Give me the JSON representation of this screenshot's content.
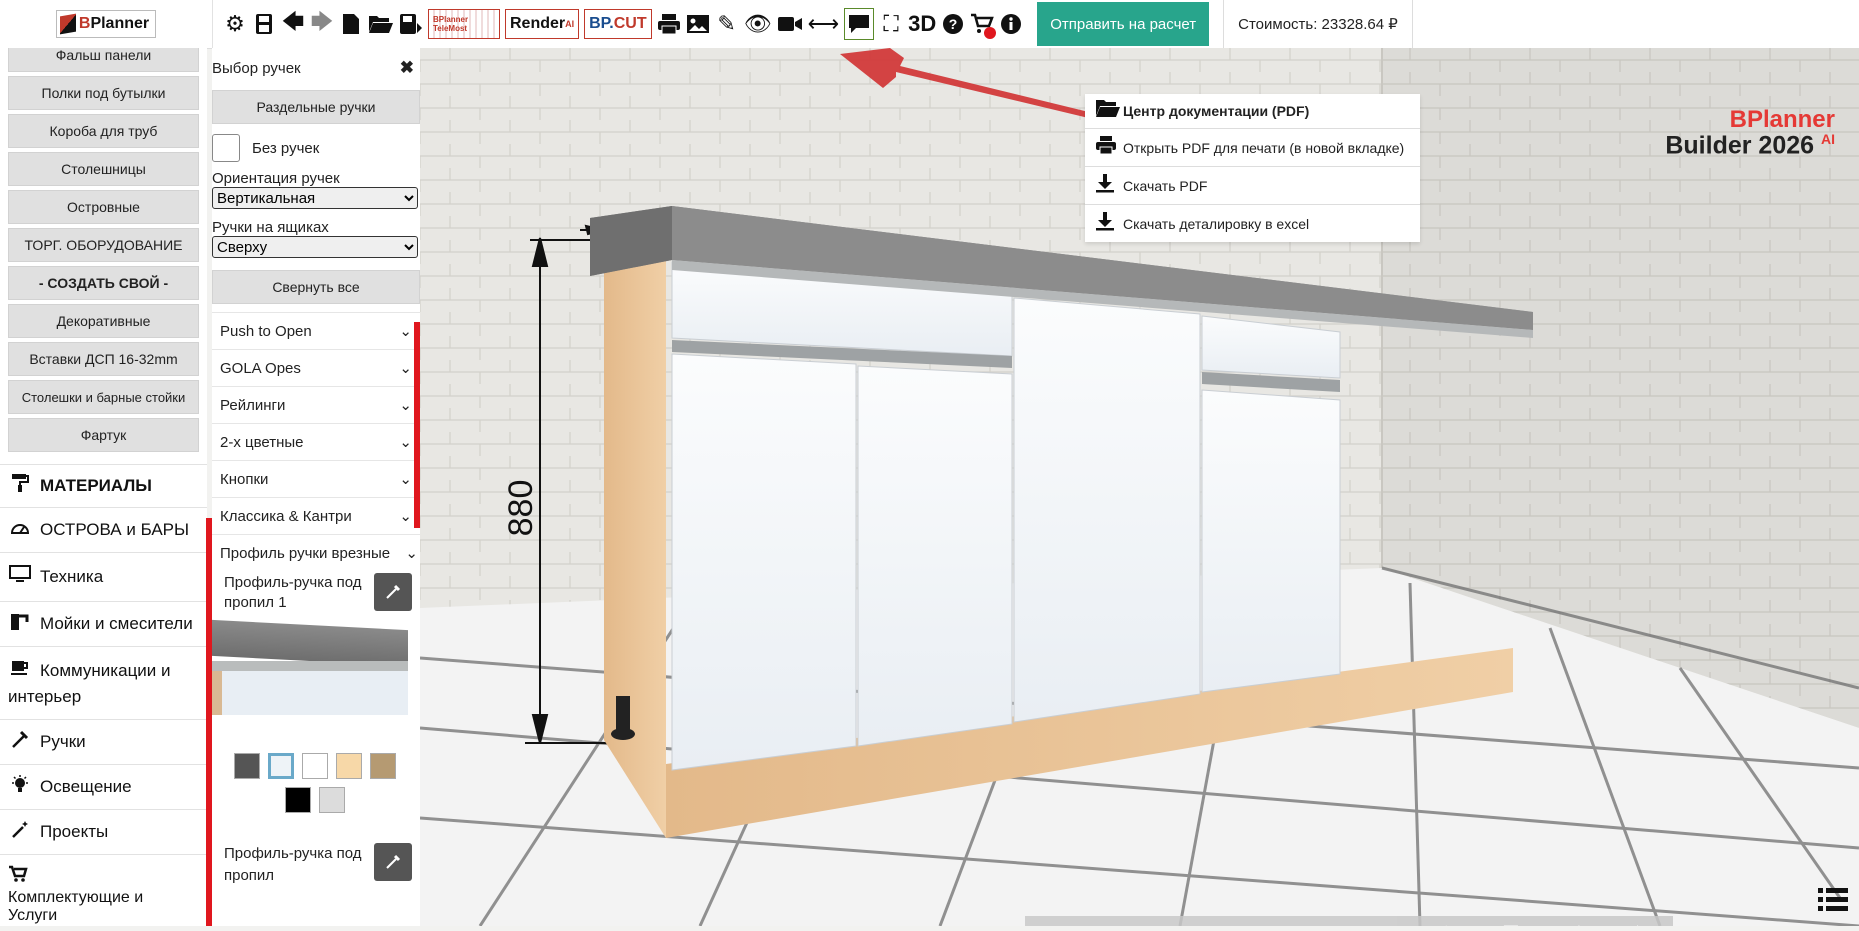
{
  "app": {
    "logo_text_b": "B",
    "logo_text": "Planner"
  },
  "toolbar": {
    "render_label": "Render",
    "render_sup": "AI",
    "cut_label_a": "BP.",
    "cut_label_b": "CUT",
    "telemost_label": "BPlanner TeleMost",
    "three_d_label": "3D",
    "send_button": "Отправить на расчет",
    "cost_text": "Стоимость: 23328.64 ₽",
    "cart_count": "0"
  },
  "categories": [
    "Фальш панели",
    "Полки под бутылки",
    "Короба для труб",
    "Столешницы",
    "Островные",
    "ТОРГ. ОБОРУДОВАНИЕ",
    "- СОЗДАТЬ СВОЙ -",
    "Декоративные",
    "Вставки ДСП 16-32mm",
    "Столешки и барные стойки",
    "Фартук"
  ],
  "menu": {
    "materials": "МАТЕРИАЛЫ",
    "islands": "ОСТРОВА и БАРЫ",
    "appliances": "Техника",
    "sinks": "Мойки и смесители",
    "communications_a": "Коммуникации и",
    "communications_b": "интерьер",
    "handles": "Ручки",
    "lighting": "Освещение",
    "projects": "Проекты",
    "accessories_a": "Комплектующие и",
    "accessories_b": "Услуги"
  },
  "handle_panel": {
    "title": "Выбор ручек",
    "close": "✖",
    "split_button": "Раздельные ручки",
    "no_handles_label": "Без ручек",
    "orientation_label": "Ориентация ручек",
    "orientation_value": "Вертикальная",
    "drawer_label": "Ручки на ящиках",
    "drawer_value": "Сверху",
    "collapse_button": "Свернуть все",
    "sections": [
      "Push to Open",
      "GOLA Opes",
      "Рейлинги",
      "2-х цветные",
      "Кнопки",
      "Классика & Кантри",
      "Профиль ручки врезные"
    ],
    "profile_item_1_a": "Профиль-ручка под",
    "profile_item_1_b": "пропил 1",
    "profile_item_2_a": "Профиль-ручка под",
    "profile_item_2_b": "пропил",
    "swatch_colors": [
      "#555555",
      "#eef3f7",
      "#ffffff",
      "#f7d8a8",
      "#b59a72",
      "#000000",
      "#dcdcdc"
    ]
  },
  "doc_menu": {
    "items": [
      "Центр документации (PDF)",
      "Открыть PDF для печати (в новой вкладке)",
      "Скачать PDF",
      "Скачать деталировку в excel"
    ]
  },
  "viewport": {
    "dimension_label": "880",
    "brand_line1": "BPlanner",
    "brand_line2": "Builder 2026",
    "brand_sup": "AI"
  },
  "colors": {
    "accent_green": "#28a58c",
    "brand_red": "#e0171e",
    "arrow_red": "#d23a3a"
  }
}
